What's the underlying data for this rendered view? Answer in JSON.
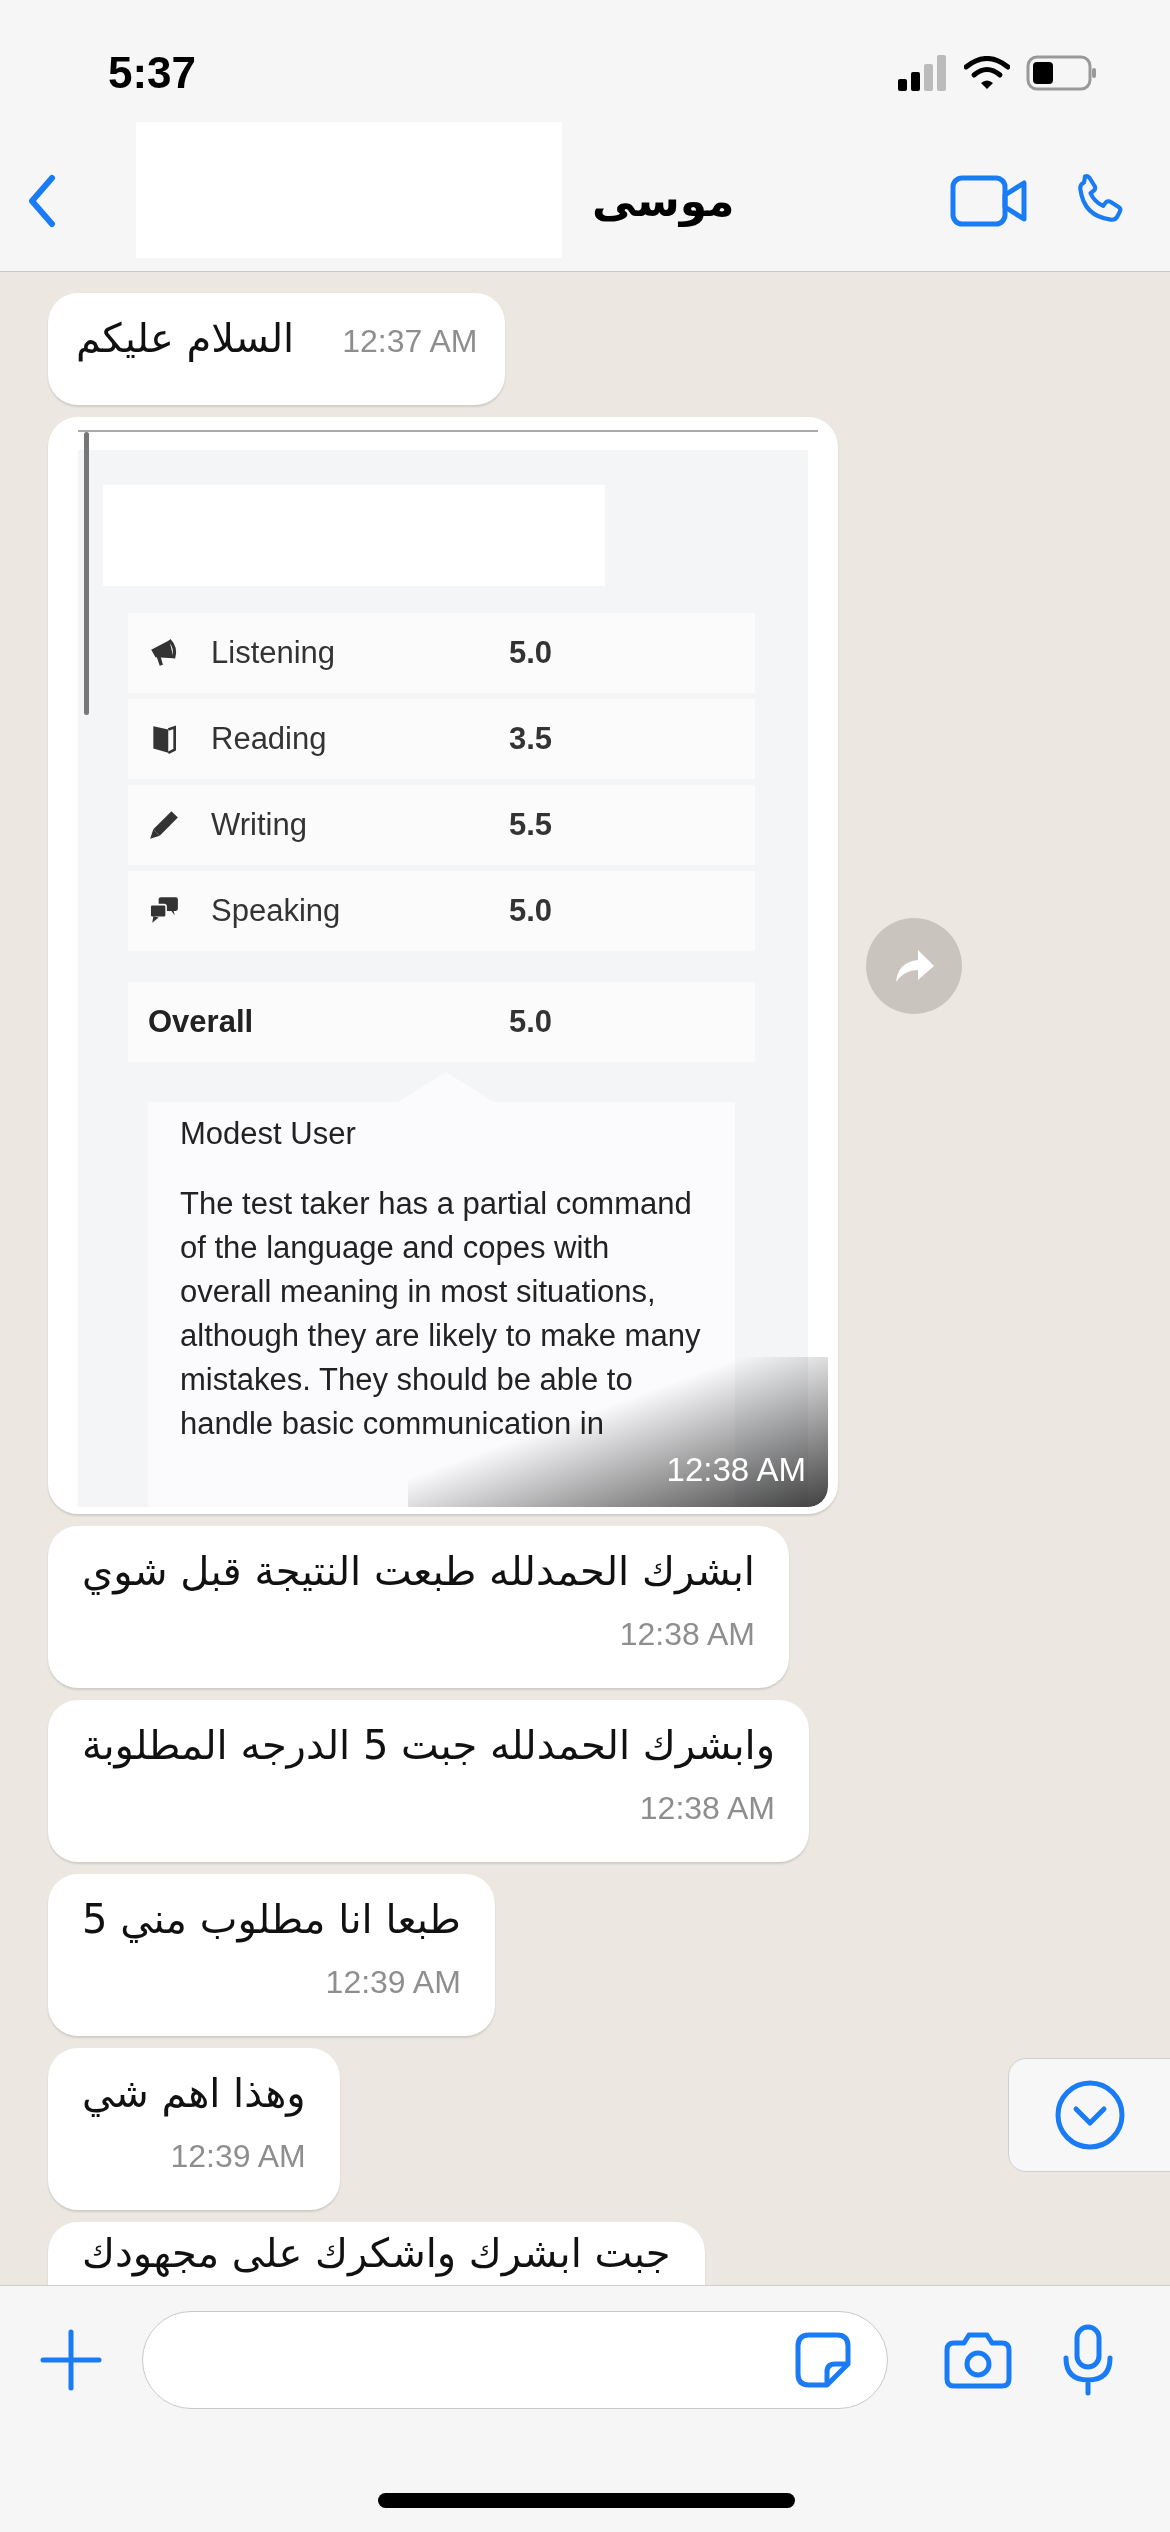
{
  "status_bar": {
    "time": "5:37"
  },
  "header": {
    "contact_name": "موسى"
  },
  "messages": [
    {
      "kind": "inline_text",
      "text": "السلام عليكم",
      "time": "12:37 AM"
    },
    {
      "kind": "image",
      "time": "12:38 AM",
      "scores": [
        {
          "label": "Listening",
          "value": "5.0"
        },
        {
          "label": "Reading",
          "value": "3.5"
        },
        {
          "label": "Writing",
          "value": "5.5"
        },
        {
          "label": "Speaking",
          "value": "5.0"
        }
      ],
      "overall": {
        "label": "Overall",
        "value": "5.0"
      },
      "band": {
        "title": "Modest User",
        "description": "The test taker has a partial command of the language and copes with overall meaning in most situations, although they are likely to make many mistakes. They should be able to handle basic communication in"
      }
    },
    {
      "kind": "text",
      "text": "ابشرك الحمدلله طبعت النتيجة قبل شوي",
      "time": "12:38 AM"
    },
    {
      "kind": "text",
      "text": "وابشرك الحمدلله جبت 5 الدرجه المطلوبة",
      "time": "12:38 AM"
    },
    {
      "kind": "text",
      "text": "طبعا انا مطلوب مني 5",
      "time": "12:39 AM"
    },
    {
      "kind": "text",
      "text": "وهذا اهم شي",
      "time": "12:39 AM"
    },
    {
      "kind": "text",
      "text": "جبت ابشرك واشكرك على مجهودك"
    }
  ]
}
